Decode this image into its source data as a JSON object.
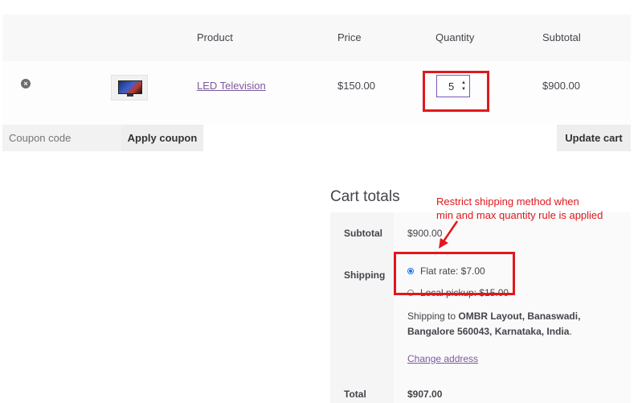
{
  "table_header": {
    "product": "Product",
    "price": "Price",
    "quantity": "Quantity",
    "subtotal": "Subtotal"
  },
  "cart_item": {
    "remove_icon": "remove-circle-icon",
    "remove_glyph": "×",
    "name": "LED Television",
    "price": "$150.00",
    "quantity": "5",
    "subtotal": "$900.00"
  },
  "coupon": {
    "placeholder": "Coupon code",
    "apply_label": "Apply coupon"
  },
  "update_label": "Update cart",
  "totals": {
    "title": "Cart totals",
    "subtotal_label": "Subtotal",
    "subtotal_value": "$900.00",
    "shipping_label": "Shipping",
    "options": [
      {
        "label": "Flat rate: $7.00",
        "selected": true
      },
      {
        "label": "Local pickup: $15.00",
        "selected": false
      }
    ],
    "shipping_to_prefix": "Shipping to",
    "shipping_address": "OMBR Layout, Banaswadi, Bangalore 560043, Karnataka, India",
    "shipping_to_suffix": ".",
    "change_address": "Change address",
    "total_label": "Total",
    "total_value": "$907.00"
  },
  "annotation": {
    "line1": "Restrict shipping method when",
    "line2": "min and max quantity rule is applied",
    "color": "#e0181d"
  },
  "colors": {
    "accent_link": "#7c5a9e",
    "highlight": "#e0181d",
    "radio_selected": "#1a73e8"
  }
}
